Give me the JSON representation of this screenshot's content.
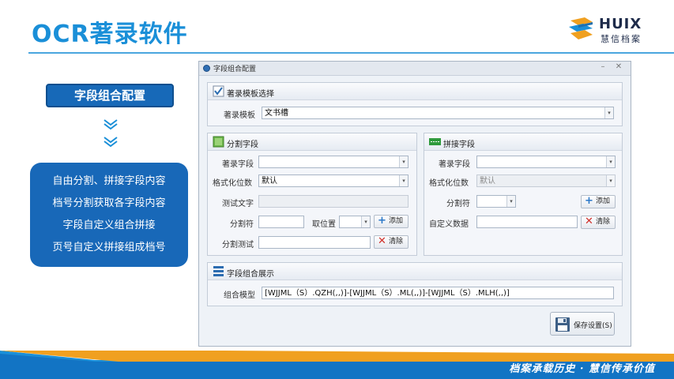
{
  "slide": {
    "title": "OCR著录软件",
    "left_label": "字段组合配置",
    "features": [
      "自由分割、拼接字段内容",
      "档号分割获取各字段内容",
      "字段自定义组合拼接",
      "页号自定义拼接组成档号"
    ],
    "footer_slogan": "档案承载历史 · 慧信传承价值",
    "colors": {
      "brand_blue": "#1a8fd8",
      "dark_blue": "#1868b8",
      "accent_orange": "#f0a020"
    }
  },
  "logo": {
    "en": "HUIX",
    "cn": "慧信档案"
  },
  "dialog": {
    "title": "字段组合配置",
    "template_panel": {
      "title": "著录模板选择",
      "template_label": "著录模板",
      "template_value": "文书槽"
    },
    "split_panel": {
      "title": "分割字段",
      "field_label": "著录字段",
      "field_value": "",
      "format_label": "格式化位数",
      "format_value": "默认",
      "test_text_label": "测试文字",
      "test_text_value": "",
      "separator_label": "分割符",
      "separator_value": "",
      "position_label": "取位置",
      "position_value": "",
      "add_label": "添加",
      "test_label": "分割测试",
      "test_value": "",
      "clear_label": "清除"
    },
    "join_panel": {
      "title": "拼接字段",
      "field_label": "著录字段",
      "field_value": "",
      "format_label": "格式化位数",
      "format_value": "默认",
      "separator_label": "分割符",
      "separator_value": "",
      "add_label": "添加",
      "custom_label": "自定义数据",
      "custom_value": "",
      "clear_label": "清除"
    },
    "combo_panel": {
      "title": "字段组合展示",
      "model_label": "组合模型",
      "model_value": "[WJJML（S）.QZH(,,)]-[WJJML（S）.ML(,,)]-[WJJML（S）.MLH(,,)]"
    },
    "save_label": "保存设置(S)",
    "window_controls": {
      "minimize": "–",
      "close": "✕"
    }
  }
}
